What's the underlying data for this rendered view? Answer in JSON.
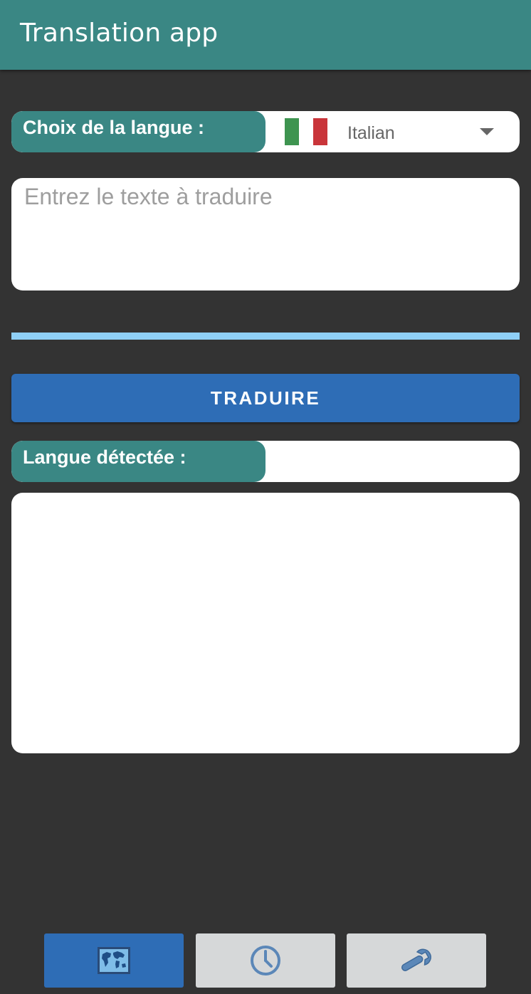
{
  "appbar": {
    "title": "Translation app"
  },
  "language_selector": {
    "label": "Choix de la langue :",
    "selected": "Italian",
    "flag_colors": [
      "#3e9450",
      "#ffffff",
      "#c9353a"
    ]
  },
  "input": {
    "placeholder": "Entrez le texte à traduire",
    "value": ""
  },
  "translate_button": {
    "label": "TRADUIRE"
  },
  "detected_language": {
    "label": "Langue détectée :",
    "value": ""
  },
  "output": {
    "text": ""
  },
  "bottom_nav": {
    "items": [
      {
        "icon": "world-map-icon",
        "active": true
      },
      {
        "icon": "clock-icon",
        "active": false
      },
      {
        "icon": "wrench-icon",
        "active": false
      }
    ]
  },
  "colors": {
    "accent_teal": "#3a8784",
    "primary_blue": "#2e6db6",
    "divider_blue": "#8fd0f7",
    "background": "#333333"
  }
}
